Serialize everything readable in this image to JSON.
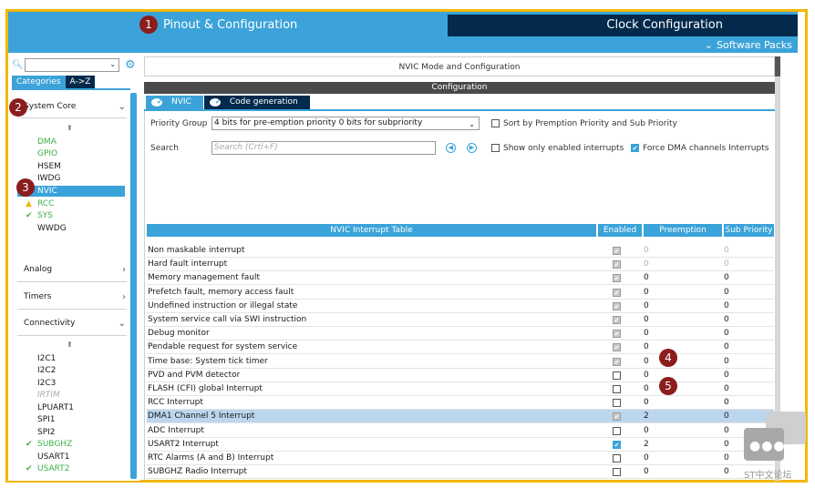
{
  "header": {
    "tab_pinout": "Pinout & Configuration",
    "tab_clock": "Clock Configuration",
    "software_packs": "Software Packs"
  },
  "badges": [
    "1",
    "2",
    "3",
    "4",
    "5"
  ],
  "left": {
    "tab_categories": "Categories",
    "tab_az": "A->Z",
    "system_core": "System Core",
    "system_core_items": [
      {
        "label": "DMA",
        "style": "green"
      },
      {
        "label": "GPIO",
        "style": "green"
      },
      {
        "label": "HSEM",
        "style": "normal"
      },
      {
        "label": "IWDG",
        "style": "normal"
      },
      {
        "label": "NVIC",
        "style": "selected"
      },
      {
        "label": "RCC",
        "style": "warn"
      },
      {
        "label": "SYS",
        "style": "check"
      },
      {
        "label": "WWDG",
        "style": "normal"
      }
    ],
    "analog": "Analog",
    "timers": "Timers",
    "connectivity": "Connectivity",
    "connectivity_items": [
      {
        "label": "I2C1",
        "style": "normal"
      },
      {
        "label": "I2C2",
        "style": "normal"
      },
      {
        "label": "I2C3",
        "style": "normal"
      },
      {
        "label": "IRTIM",
        "style": "disabled"
      },
      {
        "label": "LPUART1",
        "style": "normal"
      },
      {
        "label": "SPI1",
        "style": "normal"
      },
      {
        "label": "SPI2",
        "style": "normal"
      },
      {
        "label": "SUBGHZ",
        "style": "check"
      },
      {
        "label": "USART1",
        "style": "normal"
      },
      {
        "label": "USART2",
        "style": "check"
      }
    ]
  },
  "right": {
    "mode_title": "NVIC Mode and Configuration",
    "config_title": "Configuration",
    "tab_nvic": "NVIC",
    "tab_codegen": "Code generation",
    "priority_group_label": "Priority Group",
    "priority_group_value": "4 bits for pre-emption priority 0 bits for subpriority",
    "sort_label": "Sort by Premption Priority and Sub Priority",
    "search_label": "Search",
    "search_placeholder": "Search (Crtl+F)",
    "show_enabled_label": "Show only enabled interrupts",
    "force_dma_label": "Force DMA channels Interrupts",
    "table_headers": {
      "name": "NVIC Interrupt Table",
      "enabled": "Enabled",
      "preemption": "Preemption Priority",
      "sub": "Sub Priority"
    },
    "rows": [
      {
        "name": "Non maskable interrupt",
        "enabled": "locked",
        "pre": "0",
        "sub": "0",
        "dim": true
      },
      {
        "name": "Hard fault interrupt",
        "enabled": "locked",
        "pre": "0",
        "sub": "0",
        "dim": true
      },
      {
        "name": "Memory management fault",
        "enabled": "locked",
        "pre": "0",
        "sub": "0",
        "dim": false
      },
      {
        "name": "Prefetch fault, memory access fault",
        "enabled": "locked",
        "pre": "0",
        "sub": "0",
        "dim": false
      },
      {
        "name": "Undefined instruction or illegal state",
        "enabled": "locked",
        "pre": "0",
        "sub": "0",
        "dim": false
      },
      {
        "name": "System service call via SWI instruction",
        "enabled": "locked",
        "pre": "0",
        "sub": "0",
        "dim": false
      },
      {
        "name": "Debug monitor",
        "enabled": "locked",
        "pre": "0",
        "sub": "0",
        "dim": false
      },
      {
        "name": "Pendable request for system service",
        "enabled": "locked",
        "pre": "0",
        "sub": "0",
        "dim": false
      },
      {
        "name": "Time base: System tick timer",
        "enabled": "locked",
        "pre": "0",
        "sub": "0",
        "dim": false
      },
      {
        "name": "PVD and PVM detector",
        "enabled": "off",
        "pre": "0",
        "sub": "0",
        "dim": false
      },
      {
        "name": "FLASH (CFI)  global Interrupt",
        "enabled": "off",
        "pre": "0",
        "sub": "0",
        "dim": false
      },
      {
        "name": "RCC Interrupt",
        "enabled": "off",
        "pre": "0",
        "sub": "0",
        "dim": false
      },
      {
        "name": "DMA1 Channel 5 Interrupt",
        "enabled": "locked",
        "pre": "2",
        "sub": "0",
        "dim": false,
        "highlight": true
      },
      {
        "name": "ADC Interrupt",
        "enabled": "off",
        "pre": "0",
        "sub": "0",
        "dim": false
      },
      {
        "name": "USART2 Interrupt",
        "enabled": "on",
        "pre": "2",
        "sub": "0",
        "dim": false
      },
      {
        "name": "RTC Alarms (A and B) Interrupt",
        "enabled": "off",
        "pre": "0",
        "sub": "0",
        "dim": false
      },
      {
        "name": "SUBGHZ Radio Interrupt",
        "enabled": "off",
        "pre": "0",
        "sub": "0",
        "dim": false
      }
    ]
  },
  "watermark": "ST中文论坛"
}
